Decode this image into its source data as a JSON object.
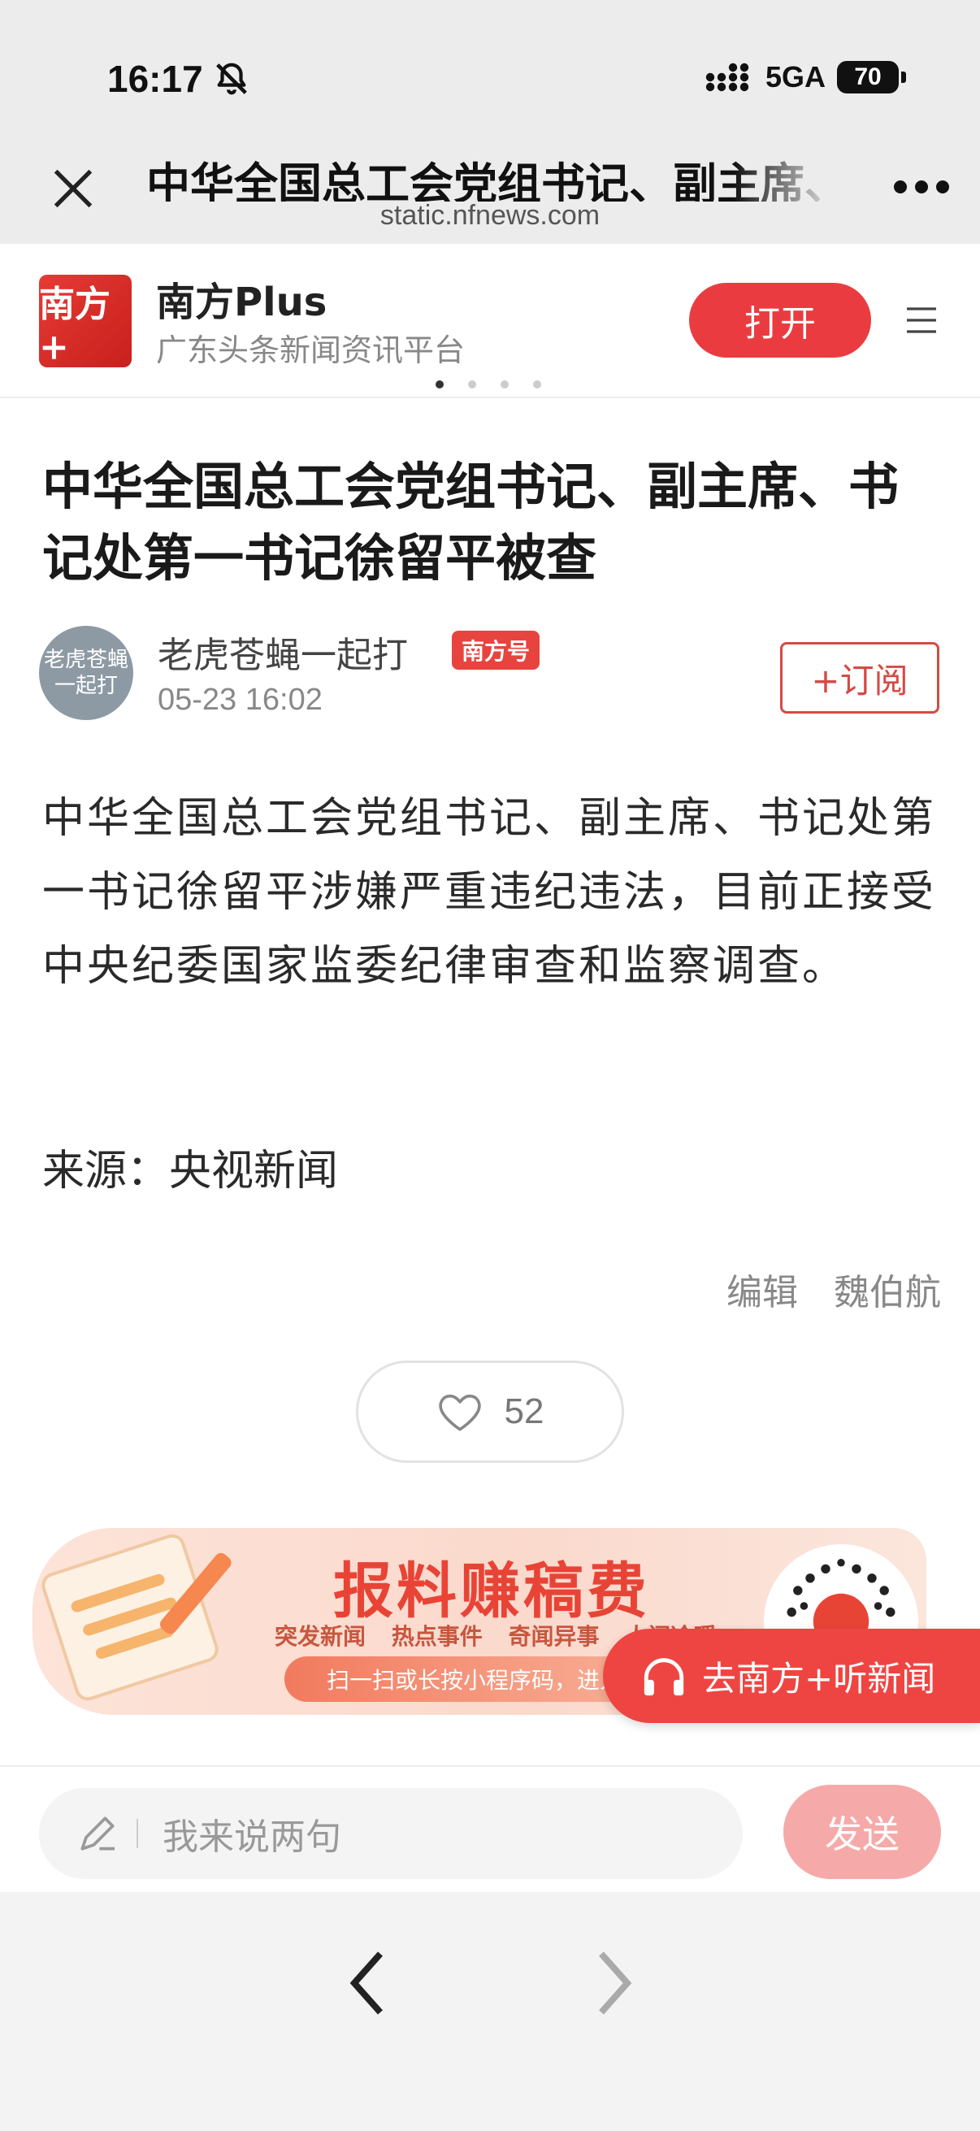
{
  "status_bar": {
    "time": "16:17",
    "network": "5GA",
    "battery": "70"
  },
  "browser": {
    "title": "中华全国总工会党组书记、副主席、书记处第一书记徐留平被查",
    "url": "static.nfnews.com"
  },
  "app_banner": {
    "logo_text": "南方+",
    "name": "南方Plus",
    "subtitle": "广东头条新闻资讯平台",
    "open_label": "打开"
  },
  "article": {
    "headline": "中华全国总工会党组书记、副主席、书记处第一书记徐留平被查",
    "author": {
      "avatar_text": "老虎苍蝇一起打",
      "name": "老虎苍蝇一起打",
      "badge": "南方号",
      "time": "05-23 16:02",
      "subscribe_label": "+订阅"
    },
    "body": "中华全国总工会党组书记、副主席、书记处第一书记徐留平涉嫌严重违纪违法，目前正接受中央纪委国家监委纪律审查和监察调查。",
    "source": "来源：央视新闻",
    "editor_label": "编辑",
    "editor_name": "魏伯航",
    "likes": "52"
  },
  "promo": {
    "title": "报料赚稿费",
    "tags": [
      "突发新闻",
      "热点事件",
      "奇闻异事",
      "人间冷暖"
    ],
    "hint": "扫一扫或长按小程序码，进入报料"
  },
  "listen_button": "去南方+听新闻",
  "comment": {
    "placeholder": "我来说两句",
    "send_label": "发送"
  },
  "colors": {
    "brand_red": "#ea3c40",
    "send_disabled": "#f6a9a9",
    "status_bg": "#ececec"
  },
  "icons": [
    "bell-muted-icon",
    "signal-icon",
    "close-icon",
    "more-icon",
    "menu-icon",
    "heart-icon",
    "headphones-icon",
    "pencil-icon",
    "chevron-left-icon",
    "chevron-right-icon"
  ]
}
